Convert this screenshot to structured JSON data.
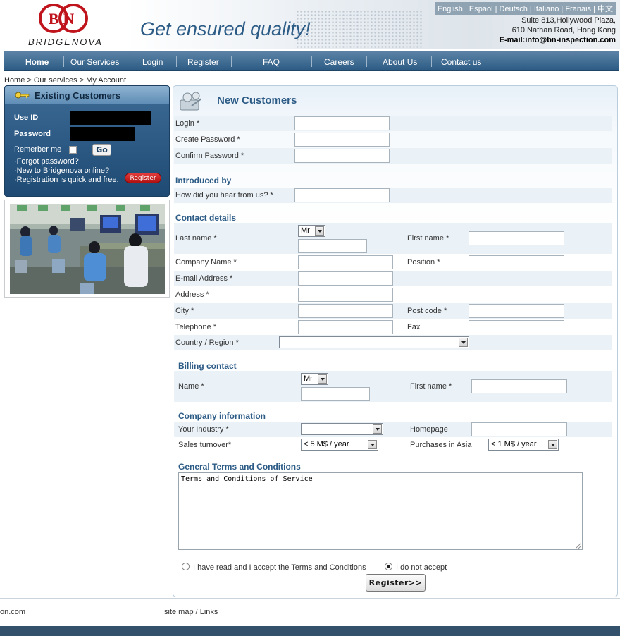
{
  "header": {
    "languages": [
      "English",
      "Espaol",
      "Deutsch",
      "Italiano",
      "Franais",
      "中文"
    ],
    "logo_letters": "BN",
    "logo_text": "BRIDGENOVA",
    "tagline": "Get ensured quality!",
    "address_line1": "Suite 813,Hollywood Plaza,",
    "address_line2": "610 Nathan Road, Hong Kong",
    "email": "E-mail:info@bn-inspection.com"
  },
  "nav": {
    "items": [
      "Home",
      "Our Services",
      "Login",
      "Register",
      "FAQ",
      "Careers",
      "About Us",
      "Contact us"
    ]
  },
  "breadcrumb": "Home > Our services > My Account",
  "login": {
    "title": "Existing Customers",
    "userid_label": "Use ID",
    "password_label": "Password",
    "remember_label": "Remerber me",
    "go_label": "Go",
    "forgot": "·Forgot password?",
    "new_to": "·New to Bridgenova online?",
    "quick": "·Registration is quick and free.",
    "register_label": "Register"
  },
  "form": {
    "title": "New Customers",
    "login_label": "Login *",
    "create_password_label": "Create Password *",
    "confirm_password_label": "Confirm Password *",
    "introduced_title": "Introduced by",
    "hear_label": "How did you hear from us? *",
    "contact_title": "Contact details",
    "title_select": "Mr",
    "last_name_label": "Last name *",
    "first_name_label": "First name *",
    "company_label": "Company Name *",
    "position_label": "Position *",
    "email_label": "E-mail Address *",
    "address_label": "Address *",
    "city_label": "City *",
    "postcode_label": "Post code *",
    "telephone_label": "Telephone *",
    "fax_label": "Fax",
    "country_label": "Country / Region *",
    "country_value": "",
    "billing_title": "Billing contact",
    "billing_title_select": "Mr",
    "billing_name_label": "Name *",
    "billing_first_name_label": "First name *",
    "company_info_title": "Company information",
    "industry_label": "Your Industry *",
    "industry_value": "",
    "homepage_label": "Homepage",
    "sales_label": "Sales turnover*",
    "sales_value": "< 5 M$ / year",
    "purchases_label": "Purchases in Asia",
    "purchases_value": "< 1 M$ / year",
    "terms_title": "General Terms and Conditions",
    "terms_text": "Terms and Conditions of Service",
    "accept_label": "I have read and I accept the Terms and Conditions",
    "decline_label": "I do not accept",
    "register_button": "Register>>"
  },
  "footer": {
    "left": "on.com",
    "links": "site map / Links"
  },
  "colors": {
    "brand_blue": "#2c5b86",
    "logo_red": "#c0141c"
  }
}
